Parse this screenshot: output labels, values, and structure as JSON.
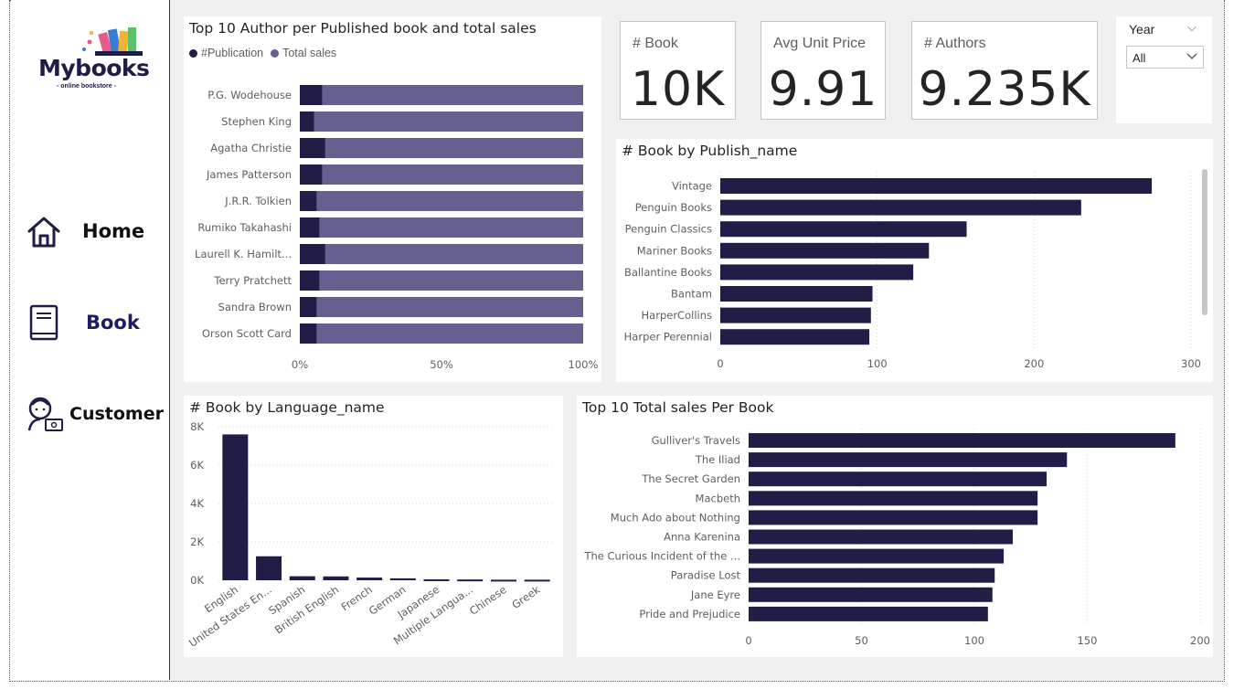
{
  "nav": {
    "logo_text": "Mybooks",
    "logo_sub": "- online bookstore -",
    "items": [
      {
        "label": "Home",
        "icon": "home-icon"
      },
      {
        "label": "Book",
        "icon": "book-icon"
      },
      {
        "label": "Customer",
        "icon": "customer-icon"
      }
    ]
  },
  "kpis": [
    {
      "label": "# Book",
      "value": "10K"
    },
    {
      "label": "Avg Unit Price",
      "value": "9.91"
    },
    {
      "label": "# Authors",
      "value": "9.235K"
    }
  ],
  "slicer": {
    "title": "Year",
    "value": "All"
  },
  "colors": {
    "dark": "#201d47",
    "light": "#65608f",
    "grid": "#d9d9d9"
  },
  "chart_data": [
    {
      "type": "bar",
      "orientation": "horizontal-stacked-100",
      "title": "Top 10 Author per Published book and total sales",
      "legend": [
        "#Publication",
        "Total sales"
      ],
      "legend_position": "top-left",
      "categories": [
        "P.G. Wodehouse",
        "Stephen King",
        "Agatha Christie",
        "James Patterson",
        "J.R.R. Tolkien",
        "Rumiko Takahashi",
        "Laurell K. Hamilt...",
        "Terry Pratchett",
        "Sandra Brown",
        "Orson Scott Card"
      ],
      "series": [
        {
          "name": "#Publication",
          "values": [
            8,
            5,
            9,
            8,
            6,
            7,
            9,
            7,
            6,
            6
          ]
        },
        {
          "name": "Total sales",
          "values": [
            92,
            95,
            91,
            92,
            94,
            93,
            91,
            93,
            94,
            94
          ]
        }
      ],
      "xticks": [
        "0%",
        "50%",
        "100%"
      ],
      "xlim": [
        0,
        100
      ]
    },
    {
      "type": "bar",
      "orientation": "horizontal",
      "title": "# Book by Publish_name",
      "categories": [
        "Vintage",
        "Penguin Books",
        "Penguin Classics",
        "Mariner Books",
        "Ballantine Books",
        "Bantam",
        "HarperCollins",
        "Harper Perennial"
      ],
      "values": [
        275,
        230,
        157,
        133,
        123,
        97,
        96,
        95
      ],
      "xticks": [
        "0",
        "100",
        "200",
        "300"
      ],
      "xlim": [
        0,
        300
      ],
      "grid": true
    },
    {
      "type": "bar",
      "orientation": "vertical",
      "title": "# Book by Language_name",
      "categories": [
        "English",
        "United States En...",
        "Spanish",
        "British English",
        "French",
        "German",
        "Japanese",
        "Multiple Langua...",
        "Chinese",
        "Greek"
      ],
      "values": [
        7600,
        1250,
        210,
        200,
        140,
        100,
        50,
        40,
        30,
        30
      ],
      "yticks": [
        "0K",
        "2K",
        "4K",
        "6K",
        "8K"
      ],
      "ylim": [
        0,
        8000
      ],
      "grid": true
    },
    {
      "type": "bar",
      "orientation": "horizontal",
      "title": "Top 10 Total sales Per Book",
      "categories": [
        "Gulliver's Travels",
        "The Iliad",
        "The Secret Garden",
        "Macbeth",
        "Much Ado about Nothing",
        "Anna Karenina",
        "The Curious Incident of the ...",
        "Paradise Lost",
        "Jane Eyre",
        "Pride and Prejudice"
      ],
      "values": [
        189,
        141,
        132,
        128,
        128,
        117,
        113,
        109,
        108,
        106
      ],
      "xticks": [
        "0",
        "50",
        "100",
        "150",
        "200"
      ],
      "xlim": [
        0,
        200
      ],
      "grid": true
    }
  ]
}
